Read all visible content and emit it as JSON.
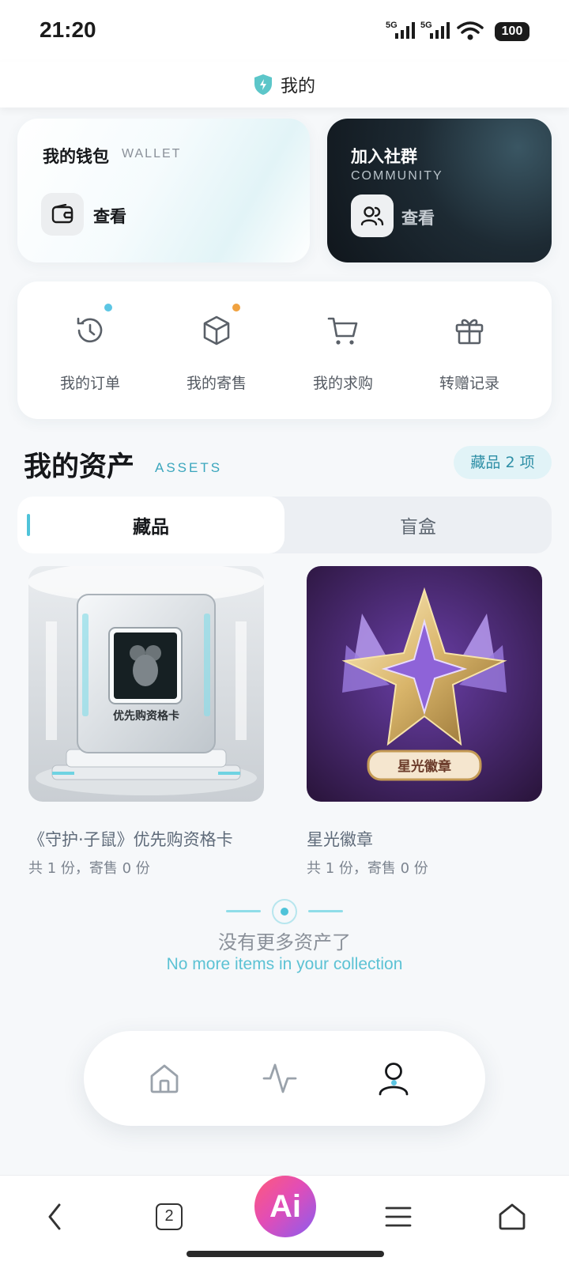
{
  "status_bar": {
    "time": "21:20",
    "network1": "5G",
    "network2": "5G",
    "battery": "100"
  },
  "header": {
    "title": "我的"
  },
  "wallet": {
    "title": "我的钱包",
    "subtitle": "WALLET",
    "view_label": "查看"
  },
  "community": {
    "title": "加入社群",
    "subtitle": "COMMUNITY",
    "view_label": "查看"
  },
  "shortcuts": [
    {
      "label": "我的订单"
    },
    {
      "label": "我的寄售"
    },
    {
      "label": "我的求购"
    },
    {
      "label": "转赠记录"
    }
  ],
  "assets": {
    "title": "我的资产",
    "subtitle": "ASSETS",
    "badge": "藏品 2 项",
    "tabs": [
      {
        "label": "藏品"
      },
      {
        "label": "盲盒"
      }
    ],
    "items": [
      {
        "name": "《守护·子鼠》优先购资格卡",
        "meta": "共 1 份，寄售 0 份",
        "image_text": "优先购资格卡"
      },
      {
        "name": "星光徽章",
        "meta": "共 1 份，寄售 0 份",
        "image_text": "星光徽章"
      }
    ],
    "end_cn": "没有更多资产了",
    "end_en": "No more items in your collection"
  },
  "browser_bar": {
    "tab_count": "2",
    "ai_label": "Ai"
  },
  "colors": {
    "accent": "#4fc3d9",
    "dot_blue": "#5cc6e4",
    "dot_orange": "#f0a240"
  }
}
